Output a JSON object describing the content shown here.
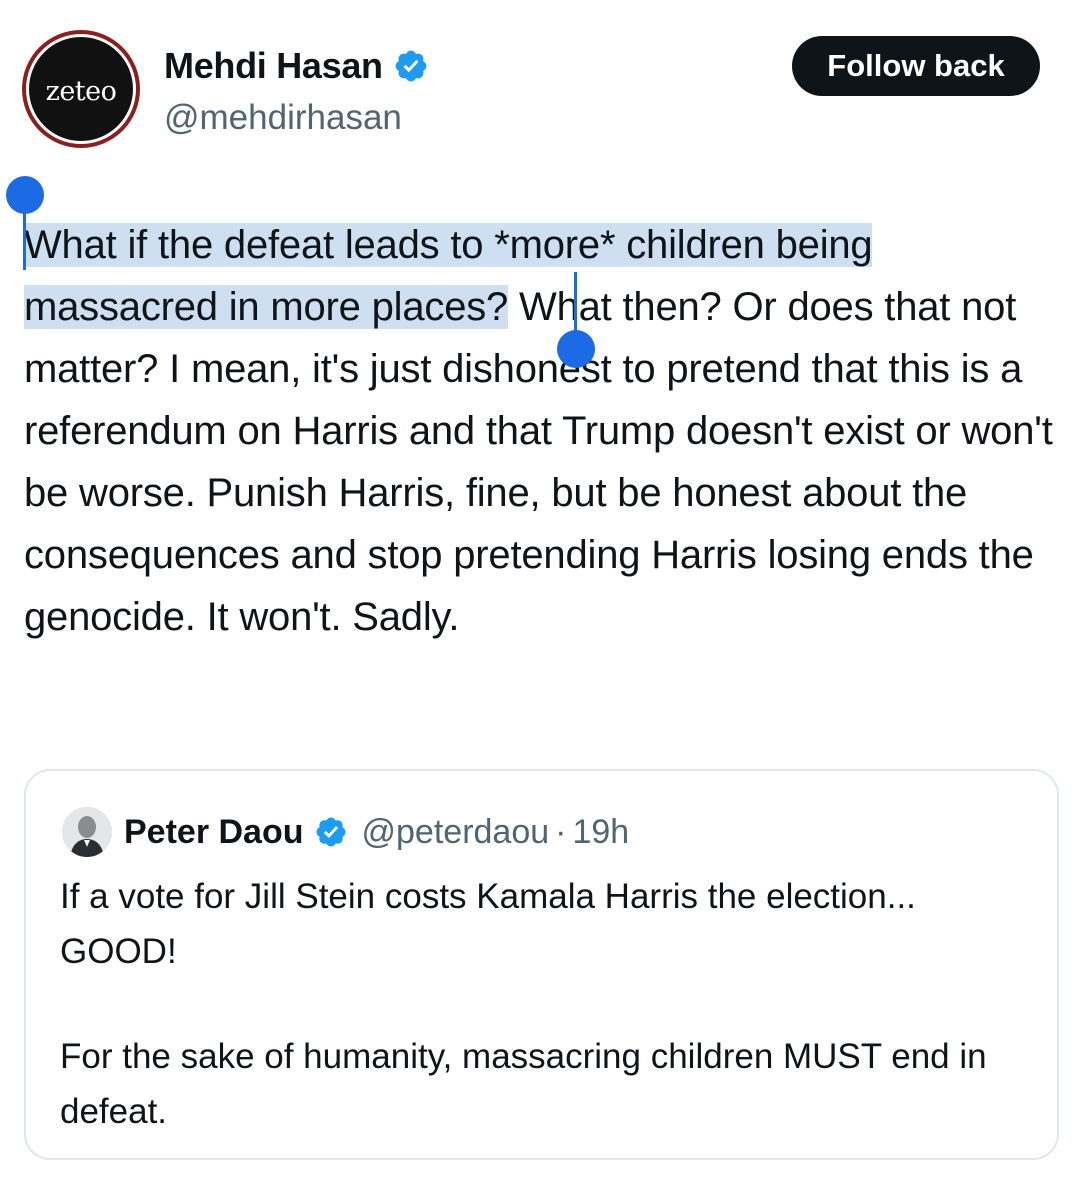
{
  "author": {
    "avatar_text": "zeteo",
    "display_name": "Mehdi Hasan",
    "handle": "@mehdirhasan",
    "verified": true,
    "follow_button_label": "Follow back"
  },
  "tweet": {
    "selected_text": "What if the defeat leads to *more* children being massacred in more places?",
    "rest_text": " What then? Or does that not matter? I mean, it's just dishonest to pretend that this is a referendum on Harris and that Trump doesn't exist or won't be worse. Punish Harris, fine, but be honest about the consequences and stop pretending Harris losing ends the genocide. It won't. Sadly."
  },
  "quoted_tweet": {
    "display_name": "Peter Daou",
    "handle": "@peterdaou",
    "separator": "·",
    "time": "19h",
    "verified": true,
    "paragraph_1": "If a vote for Jill Stein costs Kamala Harris the election... GOOD!",
    "paragraph_2": "For the sake of humanity, massacring children MUST end in defeat."
  },
  "colors": {
    "verified_blue": "#1d9bf0",
    "selection_highlight": "#cddff0",
    "selection_handle": "#1d6ae5",
    "follow_button_bg": "#0f1419",
    "secondary_text": "#536471",
    "avatar_ring": "#8a1f1f"
  }
}
